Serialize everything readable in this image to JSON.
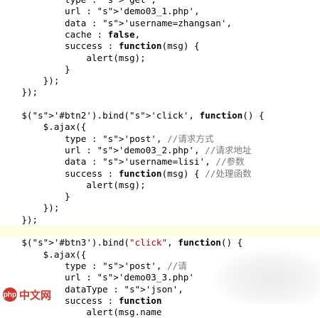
{
  "code_lines": [
    {
      "text": "            type : 'get',",
      "hl": false
    },
    {
      "text": "            url : 'demo03_1.php',",
      "hl": false
    },
    {
      "text": "            data : 'username=zhangsan',",
      "hl": false
    },
    {
      "text": "            cache : false,",
      "hl": false
    },
    {
      "text": "            success : function(msg) {",
      "hl": false
    },
    {
      "text": "                alert(msg);",
      "hl": false
    },
    {
      "text": "            }",
      "hl": false
    },
    {
      "text": "        });",
      "hl": false
    },
    {
      "text": "    });",
      "hl": false
    },
    {
      "text": "",
      "hl": false
    },
    {
      "text": "    $('#btn2').bind('click', function() {",
      "hl": false
    },
    {
      "text": "        $.ajax({",
      "hl": false
    },
    {
      "text": "            type : 'post', //请求方式",
      "hl": false
    },
    {
      "text": "            url : 'demo03_2.php', //请求地址",
      "hl": false
    },
    {
      "text": "            data : 'username=lisi', //参数",
      "hl": false
    },
    {
      "text": "            success : function(msg) { //处理函数",
      "hl": false
    },
    {
      "text": "                alert(msg);",
      "hl": false
    },
    {
      "text": "            }",
      "hl": false
    },
    {
      "text": "        });",
      "hl": false
    },
    {
      "text": "    });",
      "hl": false
    },
    {
      "text": "",
      "hl": true
    },
    {
      "text": "    $('#btn3').bind(\"click\", function() {",
      "hl": false
    },
    {
      "text": "        $.ajax({",
      "hl": false
    },
    {
      "text": "            type : 'post', //请",
      "hl": false
    },
    {
      "text": "            url : 'demo03_3.php'",
      "hl": false
    },
    {
      "text": "            dataType : 'json',",
      "hl": false
    },
    {
      "text": "            success : function",
      "hl": false
    },
    {
      "text": "                alert(msg.name",
      "hl": false
    }
  ],
  "watermark": {
    "logo_letters": "php",
    "text": "中文网"
  }
}
